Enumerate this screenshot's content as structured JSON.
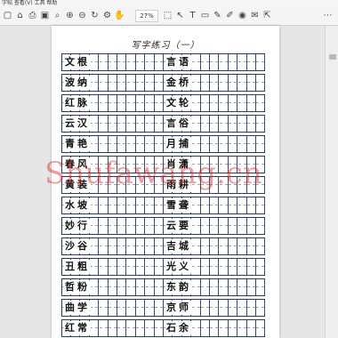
{
  "menubar": {
    "text": "字帖 查看(V) 工具 帮助"
  },
  "toolbar": {
    "icons": [
      "new-icon",
      "open-icon",
      "print-icon",
      "save-icon",
      "find-icon",
      "zoom-in-icon",
      "zoom-out-icon",
      "rotate-icon",
      "settings-icon",
      "undo-icon",
      "redo-icon",
      "hand-icon",
      "select-icon",
      "pointer-icon",
      "text-icon",
      "highlight-icon",
      "pen-icon",
      "annotate-icon",
      "stamp-icon",
      "comment-icon",
      "export-icon",
      "more-icon"
    ],
    "zoom": "27%"
  },
  "page": {
    "title": "写字练习（一）",
    "rows": [
      [
        "文根",
        "言语"
      ],
      [
        "波纳",
        "金桥"
      ],
      [
        "红脉",
        "文轮"
      ],
      [
        "云汉",
        "言俗"
      ],
      [
        "青艳",
        "月捕"
      ],
      [
        "春风",
        "肖潇"
      ],
      [
        "黄装",
        "雨耕"
      ],
      [
        "水坡",
        "雪聋"
      ],
      [
        "妙行",
        "云要"
      ],
      [
        "沙谷",
        "吉城"
      ],
      [
        "丑粗",
        "光义"
      ],
      [
        "哲粉",
        "东韵"
      ],
      [
        "曲学",
        "京师"
      ],
      [
        "红常",
        "石余"
      ]
    ]
  },
  "watermark": "Shufawang.cn"
}
